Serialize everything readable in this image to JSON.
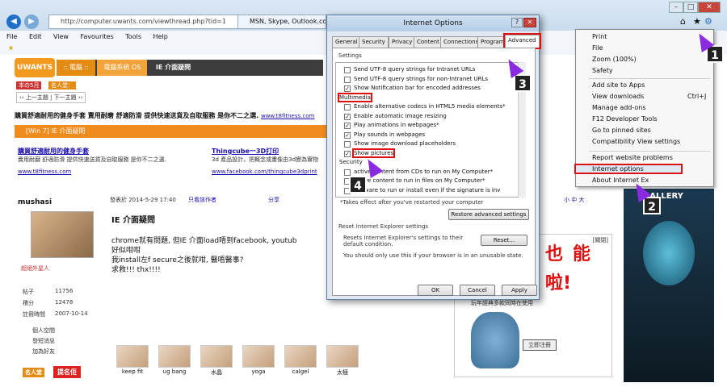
{
  "browser": {
    "url": "http://computer.uwants.com/viewthread.php?tid=1",
    "tab_title": "MSN, Skype, Outlook.com",
    "menu": [
      "File",
      "Edit",
      "View",
      "Favourites",
      "Tools",
      "Help"
    ]
  },
  "page": {
    "logo": "UWANTS",
    "crumbs": [
      ":: 電腦 ::",
      "電腦系統 OS",
      "IE 介面疑問"
    ],
    "month_label": "本の5月",
    "fame_label": "名人堂：",
    "nav_prev": "‹‹ 上一主題",
    "nav_next": "下一主題 ››",
    "promo": "購買舒適耐用的健身手套 賣用耐磨 舒適防滑 提供快速送貨及自取服務 是你不二之選.",
    "promo_url": "www.t8fitness.com",
    "band_title": "[Win 7] IE 介面疑問",
    "ad1": {
      "title": "購買舒適耐用的健身手套",
      "desc": "賣用耐磨 舒適防滑 提供快速送貨及自取服務 是你不二之選.",
      "url": "www.t8fitness.com"
    },
    "ad2": {
      "title": "Thingcube一3D打印",
      "desc": "3d 產品設計，把概念或畫像由3d變為實物",
      "url": "www.facebook.com/thingcube3dprint"
    },
    "user": {
      "name": "mushasi",
      "rank": "超絕外星人",
      "posts_label": "帖子",
      "posts": "11756",
      "points_label": "積分",
      "points": "12478",
      "reg_label": "註冊時間",
      "reg": "2007-10-14",
      "links": [
        "個人空間",
        "發短消息",
        "加為好友"
      ],
      "fame_badge": "名人堂",
      "report": "提名佢"
    },
    "post": {
      "date": "發表於 2014-5-29 17:40",
      "author_only": "只看該作者",
      "share": "分享",
      "title": "IE 介面疑問",
      "body": [
        "chrome就有問題, 但IE 介面load唔到facebook, youtub",
        "好似咁咁",
        "我install左f secure之後就咁, 醫唔醫事?",
        "求救!!! thx!!!!"
      ],
      "font_links": "小 中 大"
    },
    "gallery": [
      "keep fit",
      "ug bang",
      "水晶",
      "yoga",
      "calgel",
      "太極"
    ],
    "ad_close": "[關閉]",
    "ad_chars": [
      "也",
      "能",
      "啦!"
    ],
    "ad_caption": "玩年經典多款同時在使用",
    "ad_button": "立即注冊",
    "gallery_label": "GALLERY"
  },
  "ie_menu": {
    "items": [
      "Print",
      "File",
      "Zoom (100%)",
      "Safety",
      "Add site to Apps",
      "View downloads",
      "Manage add-ons",
      "F12 Developer Tools",
      "Go to pinned sites",
      "Compatibility View settings",
      "Report website problems",
      "Internet options",
      "About Internet Ex"
    ],
    "shortcut": "Ctrl+J"
  },
  "dialog": {
    "title": "Internet Options",
    "tabs": [
      "General",
      "Security",
      "Privacy",
      "Content",
      "Connections",
      "Programs",
      "Advanced"
    ],
    "settings_label": "Settings",
    "options": [
      {
        "label": "Send UTF-8 query strings for Intranet URLs",
        "checked": false
      },
      {
        "label": "Send UTF-8 query strings for non-Intranet URLs",
        "checked": false
      },
      {
        "label": "Show Notification bar for encoded addresses",
        "checked": true
      },
      {
        "label": "Multimedia",
        "header": true
      },
      {
        "label": "Enable alternative codecs in HTML5 media elements*",
        "checked": false
      },
      {
        "label": "Enable automatic image resizing",
        "checked": true
      },
      {
        "label": "Play animations in webpages*",
        "checked": true
      },
      {
        "label": "Play sounds in webpages",
        "checked": true
      },
      {
        "label": "Show image download placeholders",
        "checked": false
      },
      {
        "label": "Show pictures",
        "checked": true
      },
      {
        "label": "Security",
        "header": true
      },
      {
        "label": "active content from CDs to run on My Computer*",
        "checked": false
      },
      {
        "label": "active content to run in files on My Computer*",
        "checked": false
      },
      {
        "label": "software to run or install even if the signature is inv",
        "checked": false
      }
    ],
    "takes_effect": "*Takes effect after you've restarted your computer",
    "restore_btn": "Restore advanced settings",
    "reset_group": "Reset Internet Explorer settings",
    "reset_desc": "Resets Internet Explorer's settings to their default condition.",
    "reset_btn": "Reset...",
    "reset_warn": "You should only use this if your browser is in an unusable state.",
    "ok": "OK",
    "cancel": "Cancel",
    "apply": "Apply"
  },
  "badges": [
    "1",
    "2",
    "3",
    "4"
  ]
}
